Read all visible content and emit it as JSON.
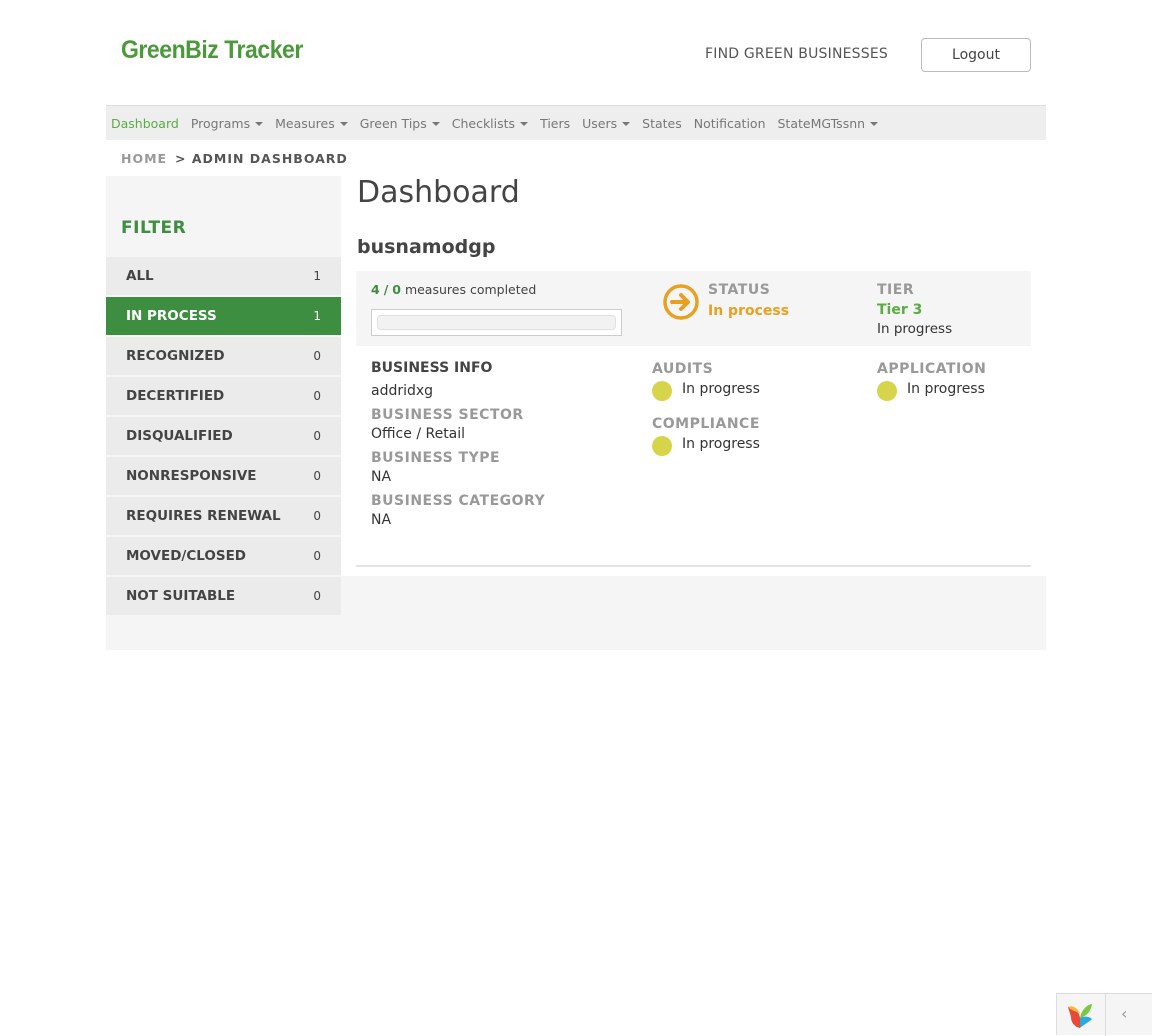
{
  "header": {
    "logo_text": "GreenBiz Tracker",
    "find_link": "FIND GREEN BUSINESSES",
    "logout_label": "Logout"
  },
  "nav": {
    "items": [
      {
        "label": "Dashboard",
        "active": true,
        "dropdown": false
      },
      {
        "label": "Programs",
        "active": false,
        "dropdown": true
      },
      {
        "label": "Measures",
        "active": false,
        "dropdown": true
      },
      {
        "label": "Green Tips",
        "active": false,
        "dropdown": true
      },
      {
        "label": "Checklists",
        "active": false,
        "dropdown": true
      },
      {
        "label": "Tiers",
        "active": false,
        "dropdown": false
      },
      {
        "label": "Users",
        "active": false,
        "dropdown": true
      },
      {
        "label": "States",
        "active": false,
        "dropdown": false
      },
      {
        "label": "Notification",
        "active": false,
        "dropdown": false
      },
      {
        "label": "StateMGTssnn",
        "active": false,
        "dropdown": true
      }
    ]
  },
  "breadcrumb": {
    "home": "HOME",
    "current": "> ADMIN DASHBOARD"
  },
  "sidebar": {
    "title": "FILTER",
    "filters": [
      {
        "label": "ALL",
        "count": "1",
        "active": false
      },
      {
        "label": "IN PROCESS",
        "count": "1",
        "active": true
      },
      {
        "label": "RECOGNIZED",
        "count": "0",
        "active": false
      },
      {
        "label": "DECERTIFIED",
        "count": "0",
        "active": false
      },
      {
        "label": "DISQUALIFIED",
        "count": "0",
        "active": false
      },
      {
        "label": "NONRESPONSIVE",
        "count": "0",
        "active": false
      },
      {
        "label": "REQUIRES RENEWAL",
        "count": "0",
        "active": false
      },
      {
        "label": "MOVED/CLOSED",
        "count": "0",
        "active": false
      },
      {
        "label": "NOT SUITABLE",
        "count": "0",
        "active": false
      }
    ]
  },
  "main": {
    "title": "Dashboard",
    "business_name": "busnamodgp",
    "measures": {
      "completed": "4",
      "separator": "/",
      "total": "0",
      "suffix": "measures completed",
      "progress": 0
    },
    "status": {
      "label": "STATUS",
      "value": "In process",
      "icon": "arrow-right-circle-icon",
      "color": "#e8a020"
    },
    "tier": {
      "label": "TIER",
      "value": "Tier 3",
      "sub": "In progress"
    },
    "business_info": {
      "heading": "BUSINESS INFO",
      "name": "addridxg",
      "sector_label": "BUSINESS SECTOR",
      "sector": "Office / Retail",
      "type_label": "BUSINESS TYPE",
      "type": "NA",
      "category_label": "BUSINESS CATEGORY",
      "category": "NA"
    },
    "audits": {
      "label": "AUDITS",
      "value": "In progress"
    },
    "compliance": {
      "label": "COMPLIANCE",
      "value": "In progress"
    },
    "application": {
      "label": "APPLICATION",
      "value": "In progress"
    }
  },
  "toolbar": {
    "logo_icon": "yii-logo-icon",
    "toggle_icon": "chevron-left-icon",
    "toggle_glyph": "‹"
  },
  "colors": {
    "brand_green": "#3e8e41",
    "nav_active": "#5aac44",
    "status_orange": "#e8a020",
    "dot_yellow": "#d6d44a"
  }
}
